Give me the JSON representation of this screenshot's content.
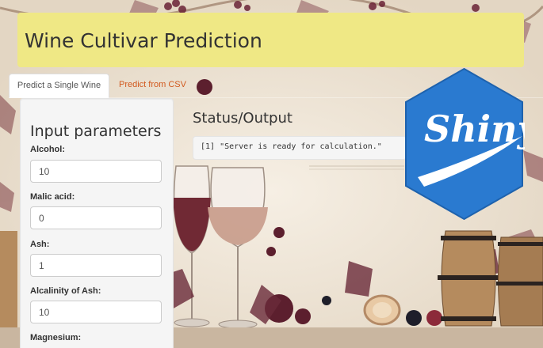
{
  "app": {
    "title": "Wine Cultivar Prediction"
  },
  "tabs": [
    {
      "label": "Predict a Single Wine",
      "active": true
    },
    {
      "label": "Predict from CSV",
      "active": false
    }
  ],
  "sidebar": {
    "heading": "Input parameters",
    "fields": [
      {
        "label": "Alcohol:",
        "value": "10"
      },
      {
        "label": "Malic acid:",
        "value": "0"
      },
      {
        "label": "Ash:",
        "value": "1"
      },
      {
        "label": "Alcalinity of Ash:",
        "value": "10"
      },
      {
        "label": "Magnesium:",
        "value": ""
      }
    ]
  },
  "main": {
    "status_heading": "Status/Output",
    "output_text": "[1] \"Server is ready for calculation.\""
  },
  "logo": {
    "text": "Shiny",
    "color": "#2a7ad0"
  },
  "colors": {
    "title_bar": "#efe885",
    "tab_link": "#d25a1f"
  },
  "icons": [
    "shiny-hex-logo"
  ]
}
